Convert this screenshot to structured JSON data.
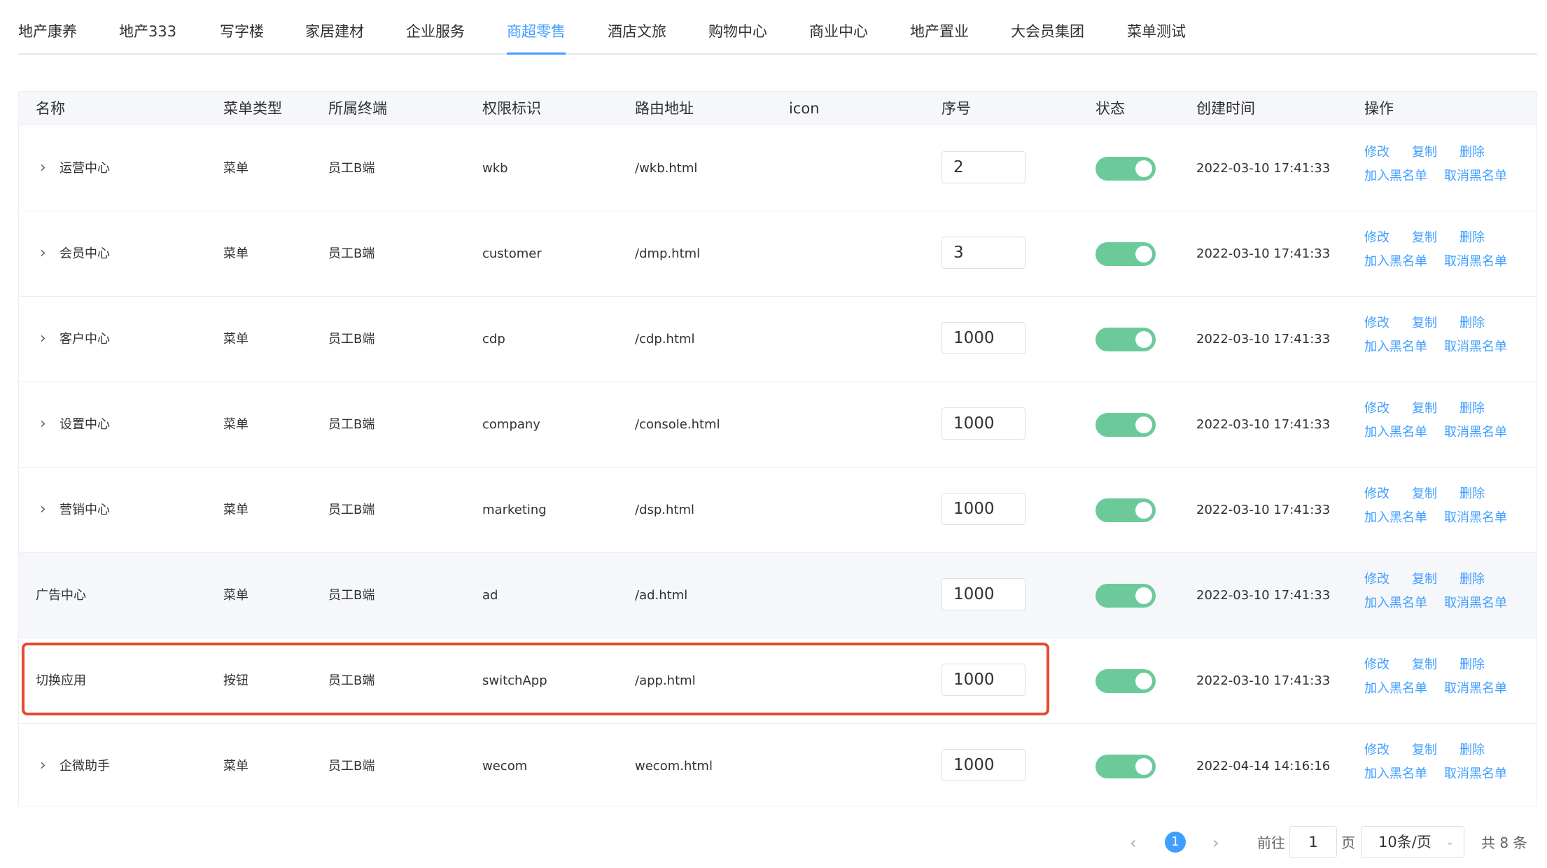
{
  "tabs": [
    {
      "label": "地产康养"
    },
    {
      "label": "地产333"
    },
    {
      "label": "写字楼"
    },
    {
      "label": "家居建材"
    },
    {
      "label": "企业服务"
    },
    {
      "label": "商超零售",
      "active": true
    },
    {
      "label": "酒店文旅"
    },
    {
      "label": "购物中心"
    },
    {
      "label": "商业中心"
    },
    {
      "label": "地产置业"
    },
    {
      "label": "大会员集团"
    },
    {
      "label": "菜单测试"
    }
  ],
  "table": {
    "headers": {
      "name": "名称",
      "type": "菜单类型",
      "terminal": "所属终端",
      "permission": "权限标识",
      "route": "路由地址",
      "icon": "icon",
      "order": "序号",
      "status": "状态",
      "created": "创建时间",
      "actions": "操作"
    },
    "actions": {
      "edit": "修改",
      "copy": "复制",
      "delete": "删除",
      "blacklist_add": "加入黑名单",
      "blacklist_remove": "取消黑名单"
    },
    "expand_icon": "chevron-right-icon",
    "rows": [
      {
        "name": "运营中心",
        "type": "菜单",
        "terminal": "员工B端",
        "permission": "wkb",
        "route": "/wkb.html",
        "order": "2",
        "status": true,
        "created": "2022-03-10 17:41:33",
        "expandable": true
      },
      {
        "name": "会员中心",
        "type": "菜单",
        "terminal": "员工B端",
        "permission": "customer",
        "route": "/dmp.html",
        "order": "3",
        "status": true,
        "created": "2022-03-10 17:41:33",
        "expandable": true
      },
      {
        "name": "客户中心",
        "type": "菜单",
        "terminal": "员工B端",
        "permission": "cdp",
        "route": "/cdp.html",
        "order": "1000",
        "status": true,
        "created": "2022-03-10 17:41:33",
        "expandable": true
      },
      {
        "name": "设置中心",
        "type": "菜单",
        "terminal": "员工B端",
        "permission": "company",
        "route": "/console.html",
        "order": "1000",
        "status": true,
        "created": "2022-03-10 17:41:33",
        "expandable": true
      },
      {
        "name": "营销中心",
        "type": "菜单",
        "terminal": "员工B端",
        "permission": "marketing",
        "route": "/dsp.html",
        "order": "1000",
        "status": true,
        "created": "2022-03-10 17:41:33",
        "expandable": true
      },
      {
        "name": "广告中心",
        "type": "菜单",
        "terminal": "员工B端",
        "permission": "ad",
        "route": "/ad.html",
        "order": "1000",
        "status": true,
        "created": "2022-03-10 17:41:33",
        "expandable": false,
        "hovered": true
      },
      {
        "name": "切换应用",
        "type": "按钮",
        "terminal": "员工B端",
        "permission": "switchApp",
        "route": "/app.html",
        "order": "1000",
        "status": true,
        "created": "2022-03-10 17:41:33",
        "expandable": false,
        "highlighted": true
      },
      {
        "name": "企微助手",
        "type": "菜单",
        "terminal": "员工B端",
        "permission": "wecom",
        "route": "wecom.html",
        "order": "1000",
        "status": true,
        "created": "2022-04-14 14:16:16",
        "expandable": true
      }
    ]
  },
  "colors": {
    "accent": "#409eff",
    "switch_on": "#6cca9a",
    "highlight_frame": "#e54a2e"
  },
  "pager": {
    "prev_icon": "chevron-left-icon",
    "next_icon": "chevron-right-icon",
    "current_page": "1",
    "goto_prefix": "前往",
    "goto_value": "1",
    "goto_suffix": "页",
    "page_size": "10条/页",
    "total": "共 8 条"
  }
}
